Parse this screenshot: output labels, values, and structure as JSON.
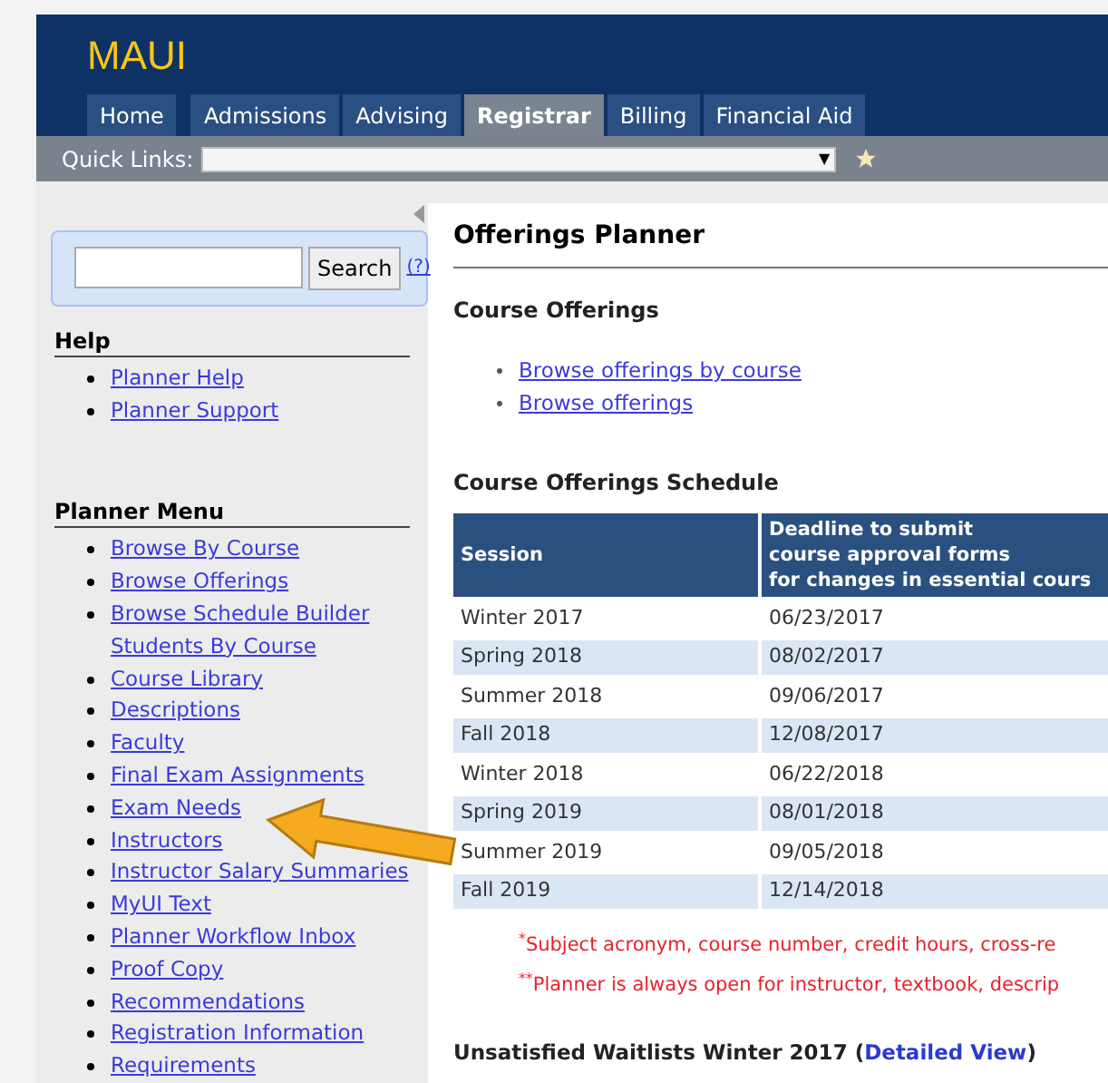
{
  "header": {
    "logo": "MAUI",
    "tabs": [
      {
        "label": "Home",
        "selected": false
      },
      {
        "label": "Admissions",
        "selected": false
      },
      {
        "label": "Advising",
        "selected": false
      },
      {
        "label": "Registrar",
        "selected": true
      },
      {
        "label": "Billing",
        "selected": false
      },
      {
        "label": "Financial Aid",
        "selected": false
      }
    ],
    "quick_links": {
      "label": "Quick Links:",
      "arrow": "▼"
    }
  },
  "sidebar": {
    "search": {
      "button": "Search",
      "help_link": "(?)"
    },
    "sections": [
      {
        "title": "Help",
        "items": [
          "Planner Help",
          "Planner Support"
        ]
      },
      {
        "title": "Planner Menu",
        "items": [
          "Browse By Course",
          "Browse Offerings",
          "Browse Schedule Builder Students By Course",
          "Course Library",
          "Descriptions",
          "Faculty",
          "Final Exam Assignments",
          "Exam Needs",
          "Instructors",
          "Instructor Salary Summaries",
          "MyUI Text",
          "Planner Workflow Inbox",
          "Proof Copy",
          "Recommendations",
          "Registration Information",
          "Requirements"
        ]
      }
    ]
  },
  "content": {
    "title": "Offerings Planner",
    "offerings_heading": "Course Offerings",
    "offerings_links": [
      "Browse offerings by course",
      "Browse offerings"
    ],
    "schedule_heading": "Course Offerings Schedule",
    "table": {
      "columns": [
        "Session",
        "Deadline to submit\ncourse approval forms\nfor changes in essential cours"
      ],
      "rows": [
        [
          "Winter 2017",
          "06/23/2017"
        ],
        [
          "Spring 2018",
          "08/02/2017"
        ],
        [
          "Summer 2018",
          "09/06/2017"
        ],
        [
          "Fall 2018",
          "12/08/2017"
        ],
        [
          "Winter 2018",
          "06/22/2018"
        ],
        [
          "Spring 2019",
          "08/01/2018"
        ],
        [
          "Summer 2019",
          "09/05/2018"
        ],
        [
          "Fall 2019",
          "12/14/2018"
        ]
      ]
    },
    "footnotes": [
      "$^{*}$Subject acronym, course number, credit hours, cross-re",
      "$^{**}$Planner is always open for instructor, textbook, descrip"
    ],
    "waitlists": {
      "heading": "Unsatisfied Waitlists Winter 2017",
      "open": "(",
      "link": "Detailed View",
      "close": ")"
    }
  }
}
